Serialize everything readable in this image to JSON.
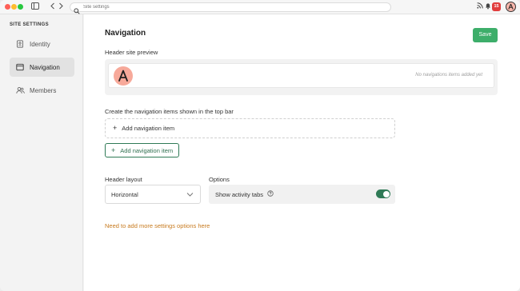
{
  "titlebar": {
    "url_placeholder": "Site settings",
    "notification_count": "15"
  },
  "sidebar": {
    "heading": "SITE SETTINGS",
    "items": [
      {
        "label": "Identity",
        "icon": "id-card-icon",
        "active": false
      },
      {
        "label": "Navigation",
        "icon": "window-icon",
        "active": true
      },
      {
        "label": "Members",
        "icon": "users-icon",
        "active": false
      }
    ]
  },
  "main": {
    "title": "Navigation",
    "save_label": "Save",
    "preview_label": "Header site preview",
    "preview_empty_text": "No navigations items added yet",
    "nav_items_label": "Create the navigation items shown in the top bar",
    "add_item_dashed_label": "Add navigation item",
    "add_item_button_label": "Add navigation item",
    "header_layout_label": "Header layout",
    "header_layout_value": "Horizontal",
    "options_label": "Options",
    "show_activity_tabs_label": "Show activity tabs",
    "show_activity_tabs_on": true,
    "more_settings_link": "Need to add more settings options here"
  },
  "colors": {
    "accent_green": "#3dae6a",
    "dark_green": "#2f7a56",
    "link_orange": "#c77a1e",
    "badge_red": "#e13d3d",
    "logo_pink": "#f7a99a"
  }
}
